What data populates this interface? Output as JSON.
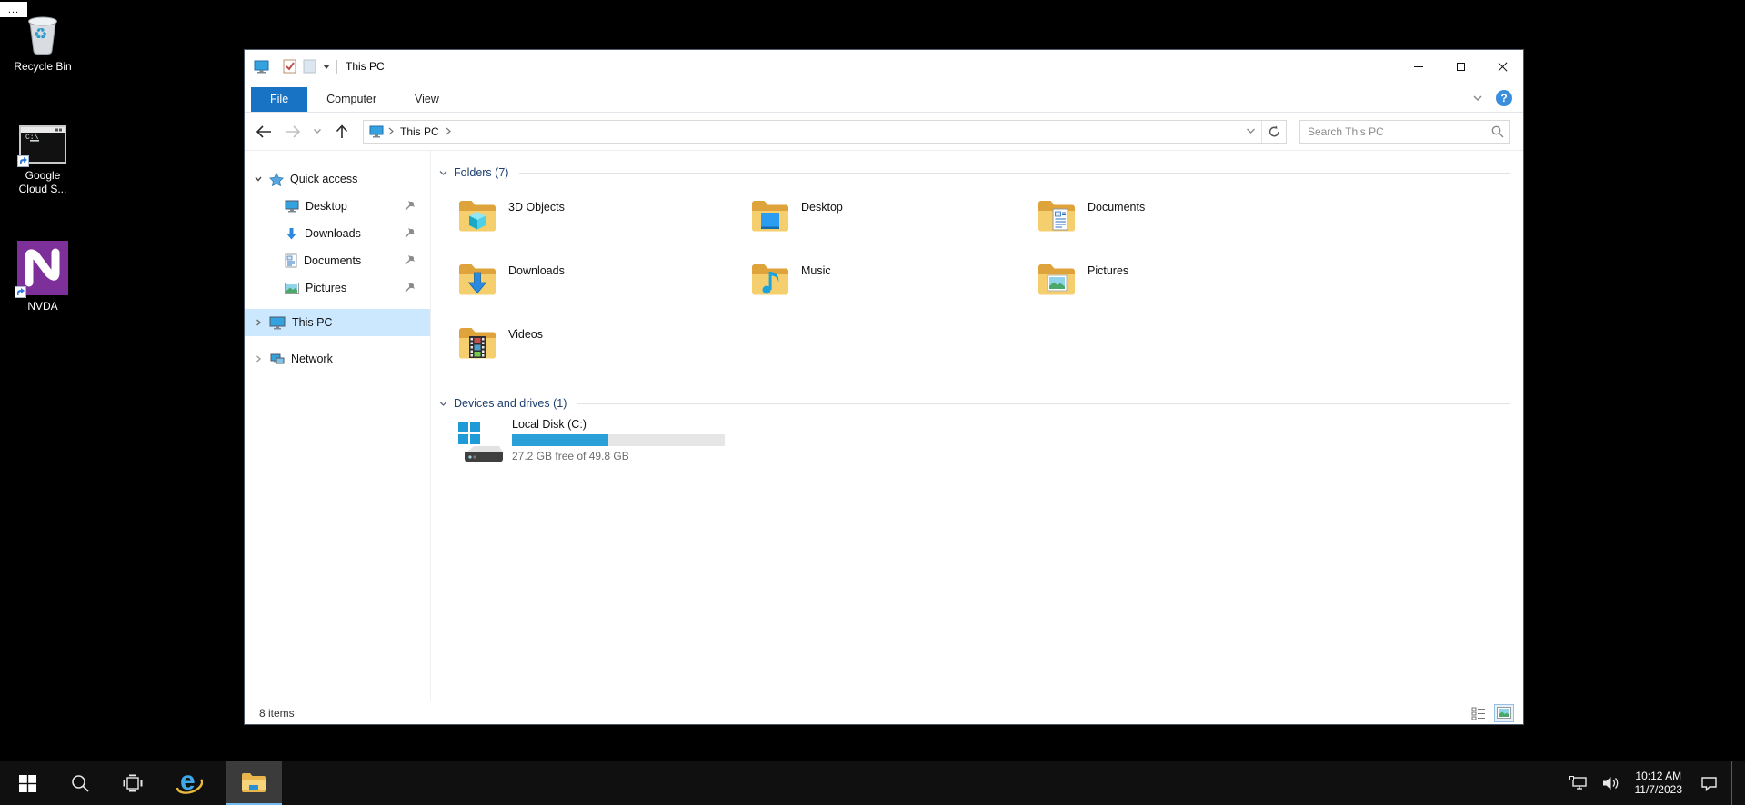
{
  "glyphs": {
    "overflow_dots": "...",
    "help": "?",
    "recycle_symbol": "♻",
    "ie_letter": "e"
  },
  "desktop": {
    "icons": [
      {
        "label": "Recycle Bin"
      },
      {
        "label": "Google Cloud S...",
        "icon_text": "C:\\"
      },
      {
        "label": "NVDA"
      }
    ]
  },
  "window": {
    "title": "This PC",
    "tabs": {
      "file": "File",
      "computer": "Computer",
      "view": "View"
    },
    "nav": {
      "breadcrumb_root": "This PC",
      "search_placeholder": "Search This PC"
    },
    "sidebar": {
      "quick_access": "Quick access",
      "items": [
        "Desktop",
        "Downloads",
        "Documents",
        "Pictures"
      ],
      "this_pc": "This PC",
      "network": "Network"
    },
    "sections": {
      "folders": "Folders (7)",
      "devices": "Devices and drives (1)"
    },
    "folders": [
      "3D Objects",
      "Desktop",
      "Documents",
      "Downloads",
      "Music",
      "Pictures",
      "Videos"
    ],
    "drive": {
      "name": "Local Disk (C:)",
      "free_text": "27.2 GB free of 49.8 GB",
      "used_percent": 45.4
    },
    "status_items": "8 items"
  },
  "taskbar": {
    "clock_time": "10:12 AM",
    "clock_date": "11/7/2023"
  }
}
